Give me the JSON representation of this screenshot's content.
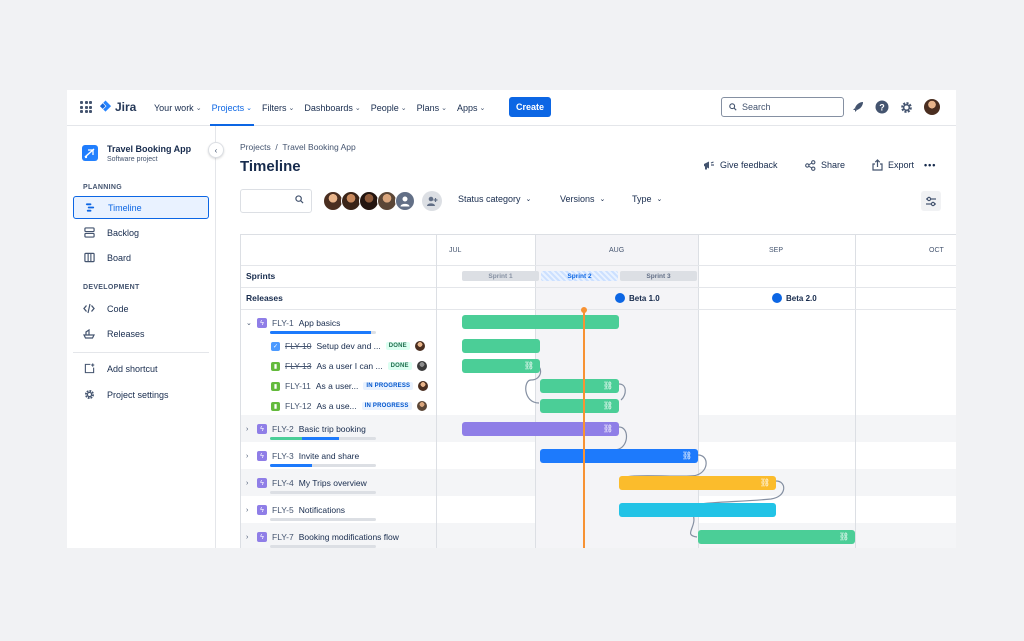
{
  "topbar": {
    "logo": "Jira",
    "nav": [
      {
        "label": "Your work",
        "active": false
      },
      {
        "label": "Projects",
        "active": true
      },
      {
        "label": "Filters",
        "active": false
      },
      {
        "label": "Dashboards",
        "active": false
      },
      {
        "label": "People",
        "active": false
      },
      {
        "label": "Plans",
        "active": false
      },
      {
        "label": "Apps",
        "active": false
      }
    ],
    "create_label": "Create",
    "search_placeholder": "Search",
    "icons": [
      "rocket-icon",
      "help-icon",
      "settings-icon",
      "profile-avatar"
    ]
  },
  "sidebar": {
    "project_name": "Travel Booking App",
    "project_type": "Software project",
    "planning_label": "PLANNING",
    "planning_items": [
      {
        "label": "Timeline",
        "icon": "timeline-icon",
        "active": true
      },
      {
        "label": "Backlog",
        "icon": "backlog-icon",
        "active": false
      },
      {
        "label": "Board",
        "icon": "board-icon",
        "active": false
      }
    ],
    "development_label": "DEVELOPMENT",
    "development_items": [
      {
        "label": "Code",
        "icon": "code-icon"
      },
      {
        "label": "Releases",
        "icon": "releases-icon"
      }
    ],
    "bottom_items": [
      {
        "label": "Add shortcut",
        "icon": "add-shortcut-icon"
      },
      {
        "label": "Project settings",
        "icon": "settings-icon"
      }
    ]
  },
  "header": {
    "breadcrumb": "Projects  /  Travel Booking App",
    "title": "Timeline",
    "actions": {
      "feedback": "Give feedback",
      "share": "Share",
      "export": "Export"
    }
  },
  "filters": {
    "status_category": "Status category",
    "versions": "Versions",
    "type": "Type"
  },
  "timeline": {
    "months": [
      "JUL",
      "AUG",
      "SEP",
      "OCT"
    ],
    "sprints_label": "Sprints",
    "releases_label": "Releases",
    "sprints": [
      "Sprint 1",
      "Sprint 2",
      "Sprint 3"
    ],
    "releases": [
      "Beta 1.0",
      "Beta 2.0"
    ],
    "epics": [
      {
        "key": "FLY-1",
        "title": "App basics",
        "expanded": true,
        "progress": 0.95,
        "progress_color": "#1d7afc",
        "children": [
          {
            "key": "FLY-10",
            "title": "Setup dev and ...",
            "status": "DONE",
            "type": "task"
          },
          {
            "key": "FLY-13",
            "title": "As a user I can ...",
            "status": "DONE",
            "type": "story"
          },
          {
            "key": "FLY-11",
            "title": "As a user...",
            "status": "IN PROGRESS",
            "type": "story"
          },
          {
            "key": "FLY-12",
            "title": "As a use...",
            "status": "IN PROGRESS",
            "type": "story"
          }
        ]
      },
      {
        "key": "FLY-2",
        "title": "Basic trip booking",
        "expanded": false,
        "progress": 0.65,
        "progress_color": "#1d7afc"
      },
      {
        "key": "FLY-3",
        "title": "Invite and share",
        "expanded": false,
        "progress": 0.4,
        "progress_color": "#1d7afc"
      },
      {
        "key": "FLY-4",
        "title": "My Trips overview",
        "expanded": false,
        "progress": 0.0,
        "progress_color": "#1d7afc"
      },
      {
        "key": "FLY-5",
        "title": "Notifications",
        "expanded": false,
        "progress": 0.0,
        "progress_color": "#1d7afc"
      },
      {
        "key": "FLY-7",
        "title": "Booking modifications flow",
        "expanded": false,
        "progress": 0.0,
        "progress_color": "#1d7afc"
      }
    ],
    "bar_colors": {
      "green": "#4bce97",
      "purple": "#8f7ee7",
      "blue": "#1d7afc",
      "yellow": "#fbbc2c",
      "teal": "#22c3e6"
    }
  }
}
